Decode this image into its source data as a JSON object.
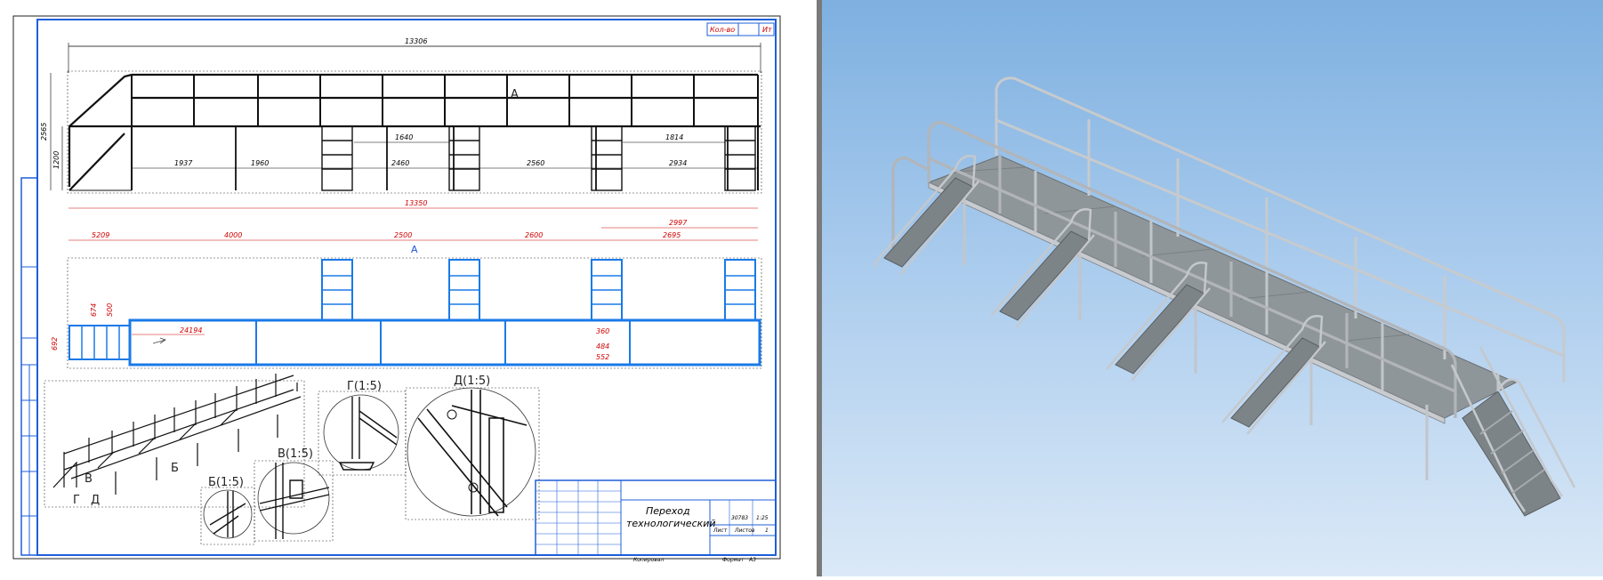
{
  "drawing": {
    "view_top": {
      "overall_length": "13306",
      "height_total": "2565",
      "height_platform": "1200",
      "segments": [
        "1937",
        "1960",
        "2460",
        "2560",
        "2934"
      ],
      "sub_dims": [
        "1640",
        "1814"
      ],
      "section_marker": "A"
    },
    "view_plan": {
      "overall_length": "13350",
      "segments": [
        "5209",
        "4000",
        "2500",
        "2600",
        "2695"
      ],
      "segment_extra": "2997",
      "section_marker": "A",
      "left_dims": [
        "674",
        "500",
        "692"
      ],
      "inner_dim": "24194",
      "right_dims": [
        "360",
        "484",
        "552"
      ]
    },
    "details": {
      "label_b": "Б",
      "label_v": "В",
      "label_g": "Г",
      "label_d": "Д",
      "detail_b_title": "Б(1:5)",
      "detail_v_title": "В(1:5)",
      "detail_g_title": "Г(1:5)",
      "detail_d_title": "Д(1:5)"
    },
    "title_block": {
      "title_line1": "Переход",
      "title_line2": "технологический",
      "qty_header": "Кол-во",
      "mass_header": "Ит",
      "mass_value": "30783",
      "scale_value": "1:25",
      "sheet_label": "Лист",
      "sheets_label": "Листов",
      "sheet_value": "1",
      "copied_label": "Копировал",
      "format_label": "Формат",
      "format_value": "A3"
    },
    "colors": {
      "frame": "#1f5fd8",
      "plan_lines": "#1a7ae8",
      "dim_red": "#d00000"
    }
  },
  "model_view": {
    "background_top": "#7eb0e0",
    "background_bottom": "#dbe9f7",
    "metal_color": "#b9bcc0",
    "deck_color": "#8f9699"
  }
}
